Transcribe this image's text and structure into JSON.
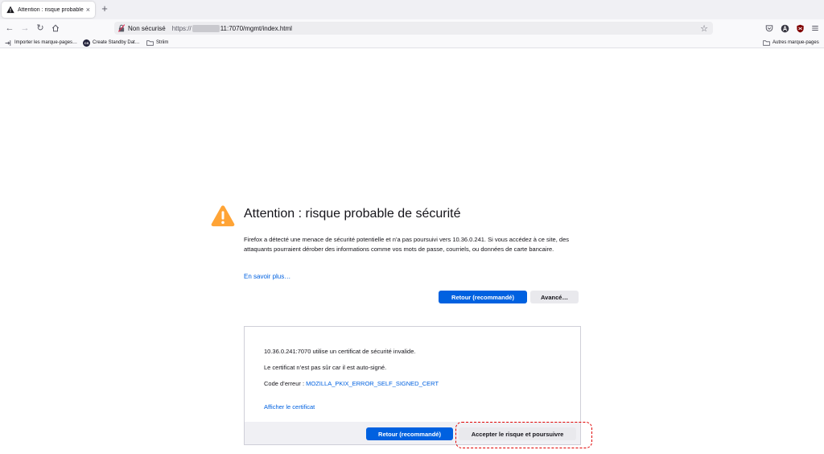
{
  "tab": {
    "title": "Attention : risque probable de sécurité",
    "close": "×",
    "new_tab": "+"
  },
  "navbar": {
    "back": "←",
    "forward": "→",
    "reload": "↻",
    "security_label": "Non sécurisé",
    "url_prefix": "https://",
    "url_suffix": "11:7070/mgmt/index.html",
    "bookmark_star": "☆"
  },
  "bookmarks": {
    "items": [
      {
        "label": "Importer les marque-pages…"
      },
      {
        "label": "Create Standby Dat…",
        "badge": "CS"
      },
      {
        "label": "Striim"
      }
    ],
    "other": "Autres marque-pages"
  },
  "page": {
    "title": "Attention : risque probable de sécurité",
    "description": "Firefox a détecté une menace de sécurité potentielle et n’a pas poursuivi vers 10.36.0.241. Si vous accédez à ce site, des attaquants pourraient dérober des informations comme vos mots de passe, courriels, ou données de carte bancaire.",
    "learn_more": "En savoir plus…",
    "back_button": "Retour (recommandé)",
    "advanced_button": "Avancé…"
  },
  "advanced": {
    "line1": "10.36.0.241:7070 utilise un certificat de sécurité invalide.",
    "line2": "Le certificat n’est pas sûr car il est auto-signé.",
    "error_label": "Code d’erreur : ",
    "error_code": "MOZILLA_PKIX_ERROR_SELF_SIGNED_CERT",
    "view_cert": "Afficher le certificat",
    "back_button": "Retour (recommandé)",
    "accept_button": "Accepter le risque et poursuivre"
  },
  "colors": {
    "accent": "#0061e0",
    "warning": "#ffa436",
    "highlight": "#e00000"
  }
}
